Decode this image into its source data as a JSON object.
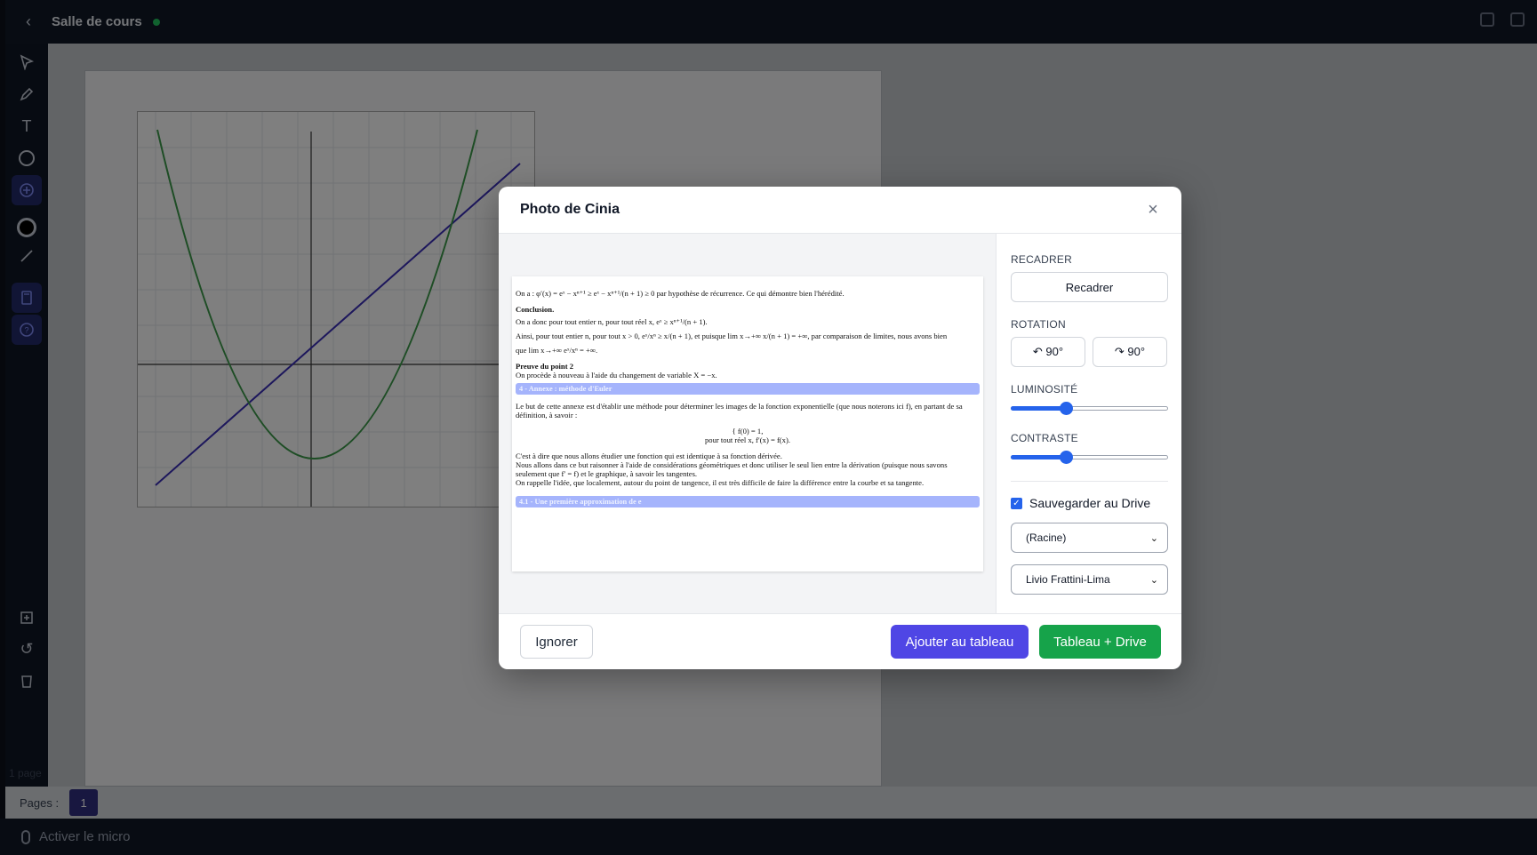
{
  "app": {
    "room_title": "Salle de cours",
    "status_color": "#22c55e",
    "accent_color": "#4f46e5"
  },
  "sidebar": {
    "tools": [
      {
        "icon": "pointer-icon"
      },
      {
        "icon": "pen-icon"
      },
      {
        "icon": "text-icon"
      },
      {
        "icon": "shape-circle-icon"
      },
      {
        "icon": "add-circle-icon",
        "active": true
      },
      {
        "icon": "color-picker-icon",
        "color": "#000000"
      },
      {
        "icon": "line-icon"
      },
      {
        "icon": "notebook-icon",
        "active": true
      },
      {
        "icon": "help-icon",
        "active": true
      },
      {
        "icon": "add-page-icon"
      },
      {
        "icon": "undo-icon"
      },
      {
        "icon": "trash-icon"
      }
    ],
    "page_count": "1 page"
  },
  "pages_bar": {
    "label": "Pages :",
    "current": "1"
  },
  "bottom_bar": {
    "mic_label": "Activer le micro"
  },
  "modal": {
    "title": "Photo de Cinia",
    "close_icon": "close-icon",
    "doc": {
      "line1": "On a : φ′(x) = eˣ − xⁿ⁺¹ ≥ eˣ − xⁿ⁺¹/(n + 1) ≥ 0 par hypothèse de récurrence. Ce qui démontre bien l'hérédité.",
      "conclusion": "Conclusion.",
      "line2": "On a donc pour tout entier n, pour tout réel x, eˣ ≥ xⁿ⁺¹/(n + 1).",
      "line3": "Ainsi, pour tout entier n, pour tout x > 0, eˣ/xⁿ ≥ x/(n + 1), et puisque lim x→+∞ x/(n + 1) = +∞, par comparaison de limites, nous avons bien",
      "line4": "que lim x→+∞ eˣ/xⁿ = +∞.",
      "proof_title": "Preuve du point 2",
      "proof_text": "On procède à nouveau à l'aide du changement de variable X = −x.",
      "section4": "4 - Annexe : méthode d'Euler",
      "para1": "Le but de cette annexe est d'établir une méthode pour déterminer les images de la fonction exponentielle (que nous noterons ici f), en partant de sa définition, à savoir :",
      "system1": "{ f(0) = 1,",
      "system2": "pour tout réel x, f′(x) = f(x).",
      "para2": "C'est à dire que nous allons étudier une fonction qui est identique à sa fonction dérivée.",
      "para3": "Nous allons dans ce but raisonner à l'aide de considérations géométriques et donc utiliser le seul lien entre la dérivation (puisque nous savons seulement que f′ = f) et le graphique, à savoir les tangentes.",
      "para4": "On rappelle l'idée, que localement, autour du point de tangence, il est très difficile de faire la différence entre la courbe et sa tangente.",
      "section41": "4.1 - Une première approximation de e"
    },
    "controls": {
      "recadrer_label": "RECADRER",
      "recadrer_button": "Recadrer",
      "rotation_label": "ROTATION",
      "rotate_left": "↶ 90°",
      "rotate_right": "↷ 90°",
      "brightness_label": "LUMINOSITÉ",
      "brightness_value": 0.35,
      "contrast_label": "CONTRASTE",
      "contrast_value": 0.35,
      "save_drive_label": "Sauvegarder au Drive",
      "save_drive_checked": true,
      "folder_value": "(Racine)",
      "owner_value": "Livio Frattini-Lima"
    },
    "footer": {
      "ignore": "Ignorer",
      "add_to_board": "Ajouter au tableau",
      "board_and_drive": "Tableau + Drive"
    }
  }
}
